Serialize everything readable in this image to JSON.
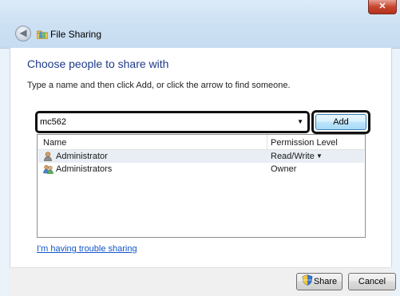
{
  "window": {
    "title": "File Sharing",
    "close_label": "✕"
  },
  "main": {
    "heading": "Choose people to share with",
    "instruction": "Type a name and then click Add, or click the arrow to find someone."
  },
  "name_entry": {
    "value": "mc562",
    "add_label": "Add"
  },
  "share_list": {
    "columns": [
      "Name",
      "Permission Level"
    ],
    "rows": [
      {
        "name": "Administrator",
        "permission": "Read/Write",
        "icon": "user-icon",
        "has_dropdown": true
      },
      {
        "name": "Administrators",
        "permission": "Owner",
        "icon": "user-group-icon",
        "has_dropdown": false
      }
    ]
  },
  "links": {
    "trouble": "I'm having trouble sharing"
  },
  "buttons": {
    "share": "Share",
    "cancel": "Cancel"
  },
  "colors": {
    "heading": "#1e3a8a",
    "link": "#1155cc",
    "selected_row": "#e8eef4"
  }
}
